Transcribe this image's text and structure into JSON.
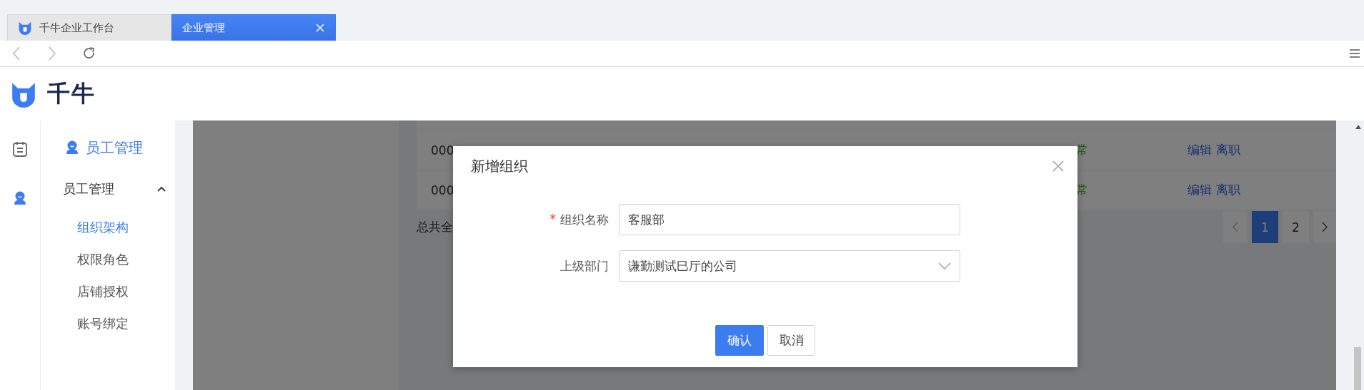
{
  "browser": {
    "tabs": [
      {
        "label": "千牛企业工作台",
        "selected": false
      },
      {
        "label": "企业管理",
        "selected": true
      }
    ]
  },
  "header": {
    "logo_text": "千牛"
  },
  "rail": {
    "items": [
      {
        "kind": "clipboard",
        "selected": false
      },
      {
        "kind": "person",
        "selected": true
      }
    ]
  },
  "sidebar": {
    "title": "员工管理",
    "groups": [
      {
        "label": "员工管理",
        "expanded": true,
        "children": [
          {
            "label": "组织架构",
            "selected": true
          },
          {
            "label": "权限角色",
            "selected": false
          },
          {
            "label": "店铺授权",
            "selected": false
          },
          {
            "label": "账号绑定",
            "selected": false
          }
        ]
      }
    ]
  },
  "table": {
    "rows": [
      {
        "id": "000",
        "status": "常",
        "actions": [
          "编辑",
          "离职"
        ]
      },
      {
        "id": "000",
        "status": "常",
        "actions": [
          "编辑",
          "离职"
        ]
      }
    ]
  },
  "summary": "总共全",
  "pagination": {
    "pages": [
      {
        "label": "1",
        "selected": true
      },
      {
        "label": "2",
        "selected": false
      }
    ]
  },
  "dialog": {
    "title": "新增组织",
    "fields": [
      {
        "kind": "input",
        "required_mark": "*",
        "label": "组织名称",
        "value": "客服部"
      },
      {
        "kind": "select",
        "label": "上级部门",
        "value": "谦勤测试巳厅的公司"
      }
    ],
    "buttons": [
      {
        "kind": "primary",
        "label": "确认"
      },
      {
        "kind": "default",
        "label": "取消"
      }
    ]
  }
}
